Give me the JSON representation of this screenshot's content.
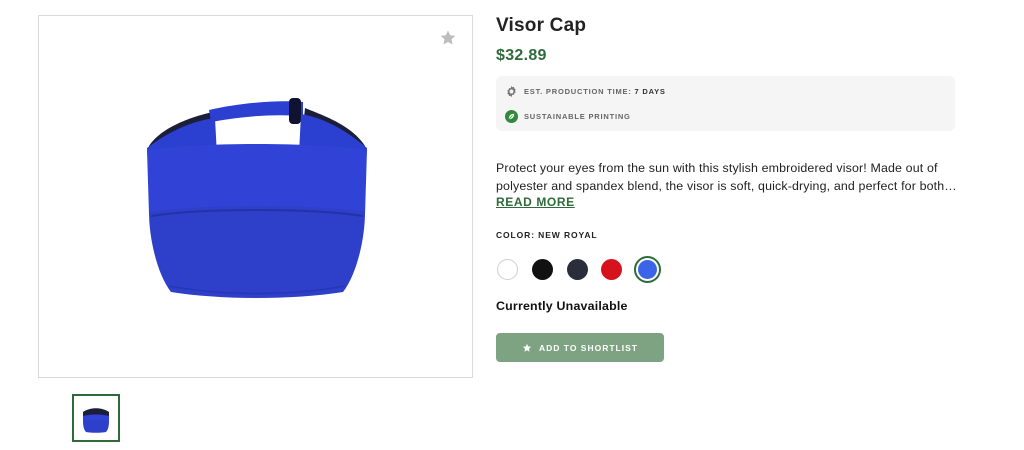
{
  "product": {
    "title": "Visor Cap",
    "price": "$32.89"
  },
  "info": {
    "production_label": "EST. PRODUCTION TIME:",
    "production_value": "7 DAYS",
    "production_icon": "gear-icon",
    "sustainable_label": "SUSTAINABLE PRINTING",
    "sustainable_icon": "leaf-icon"
  },
  "description": {
    "line1": "Protect your eyes from the sun with this stylish embroidered visor! Made out of",
    "line2": "polyester and spandex blend, the visor is soft, quick-drying, and perfect for both…",
    "read_more": "READ MORE"
  },
  "color": {
    "label": "COLOR: NEW ROYAL",
    "selected": "New Royal",
    "swatches": [
      {
        "color": "#ffffff"
      },
      {
        "color": "#111111"
      },
      {
        "color": "#2b2d3b"
      },
      {
        "color": "#d6131d"
      },
      {
        "color": "#3b64e8"
      }
    ]
  },
  "availability": "Currently Unavailable",
  "shortlist": {
    "label": "ADD TO SHORTLIST",
    "icon": "star-icon"
  },
  "gallery": {
    "favorite_icon": "star-icon",
    "visor_color": "#2e3fc9",
    "thumbnail_count": 1
  },
  "colors": {
    "accent_green": "#2f6b3a",
    "button_green": "#7ea383"
  }
}
